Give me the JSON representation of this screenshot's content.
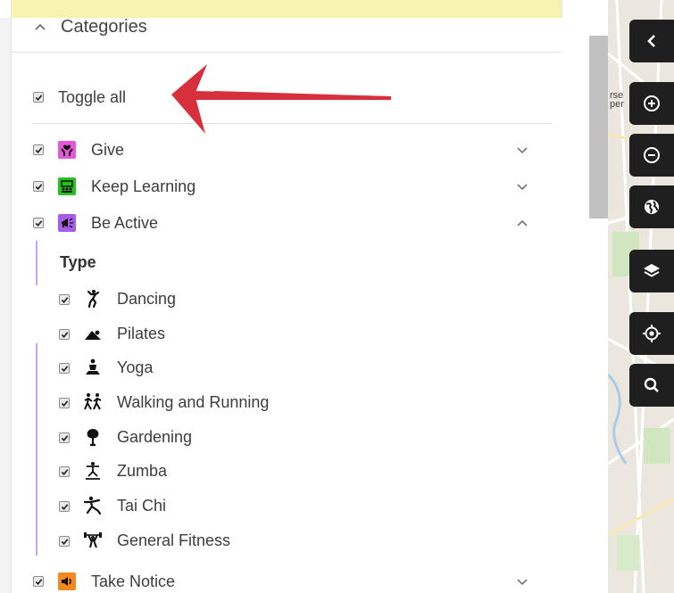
{
  "panel": {
    "title": "Categories",
    "collapse_icon": "chevron-up-icon",
    "toggle_all": {
      "label": "Toggle all",
      "checked": true
    }
  },
  "categories": [
    {
      "key": "give",
      "label": "Give",
      "checked": true,
      "color": "#e557d6",
      "icon": "hands-heart-icon",
      "expander": "chevron-down-icon"
    },
    {
      "key": "keep-learning",
      "label": "Keep Learning",
      "checked": true,
      "color": "#22c31f",
      "icon": "classroom-icon",
      "expander": "chevron-down-icon"
    },
    {
      "key": "be-active",
      "label": "Be Active",
      "checked": true,
      "color": "#a65ce6",
      "icon": "megaphone-icon",
      "expander": "chevron-up-icon"
    },
    {
      "key": "take-notice",
      "label": "Take Notice",
      "checked": true,
      "color": "#f08a1e",
      "icon": "speaker-icon",
      "expander": "chevron-down-icon"
    }
  ],
  "be_active_filter": {
    "heading": "Type",
    "items": [
      {
        "label": "Dancing",
        "checked": true,
        "icon": "dancer-icon"
      },
      {
        "label": "Pilates",
        "checked": true,
        "icon": "pilates-icon"
      },
      {
        "label": "Yoga",
        "checked": true,
        "icon": "yoga-icon"
      },
      {
        "label": "Walking and Running",
        "checked": true,
        "icon": "walking-running-icon"
      },
      {
        "label": "Gardening",
        "checked": true,
        "icon": "gardening-icon"
      },
      {
        "label": "Zumba",
        "checked": true,
        "icon": "zumba-icon"
      },
      {
        "label": "Tai Chi",
        "checked": true,
        "icon": "tai-chi-icon"
      },
      {
        "label": "General Fitness",
        "checked": true,
        "icon": "weightlifting-icon"
      }
    ]
  },
  "map_controls": [
    {
      "name": "collapse-panel-button",
      "icon": "chevron-left-icon"
    },
    {
      "name": "zoom-in-button",
      "icon": "zoom-in-icon"
    },
    {
      "name": "zoom-out-button",
      "icon": "zoom-out-icon"
    },
    {
      "name": "world-view-button",
      "icon": "globe-icon"
    },
    {
      "name": "layers-button",
      "icon": "layers-icon"
    },
    {
      "name": "locate-me-button",
      "icon": "crosshair-icon"
    },
    {
      "name": "map-search-button",
      "icon": "search-icon"
    }
  ],
  "map_labels": [
    "rse",
    "per"
  ],
  "annotation": {
    "icon": "red-arrow-icon",
    "color": "#d6303c"
  }
}
